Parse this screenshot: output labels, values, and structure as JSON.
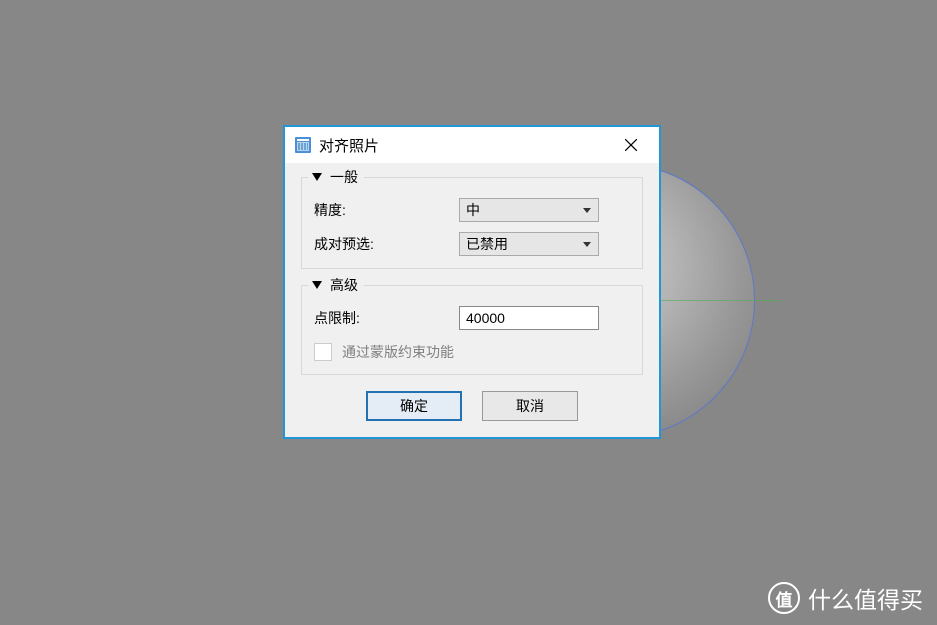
{
  "dialog": {
    "title": "对齐照片",
    "groups": {
      "general": {
        "title": "一般",
        "accuracy_label": "精度:",
        "accuracy_value": "中",
        "pair_label": "成对预选:",
        "pair_value": "已禁用"
      },
      "advanced": {
        "title": "高级",
        "pointlimit_label": "点限制:",
        "pointlimit_value": "40000",
        "checkbox_label": "通过蒙版约束功能"
      }
    },
    "buttons": {
      "ok": "确定",
      "cancel": "取消"
    }
  },
  "watermark": {
    "badge": "值",
    "text": "什么值得买"
  }
}
